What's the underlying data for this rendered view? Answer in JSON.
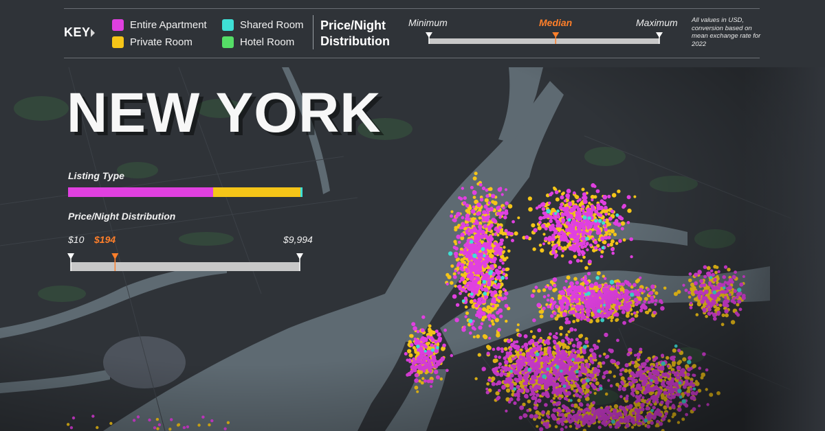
{
  "key": {
    "label": "KEY"
  },
  "legend": [
    {
      "label": "Entire Apartment",
      "color": "#e040e0"
    },
    {
      "label": "Private Room",
      "color": "#f5c518"
    },
    {
      "label": "Shared Room",
      "color": "#3ee0d6"
    },
    {
      "label": "Hotel Room",
      "color": "#55dd66"
    }
  ],
  "price_header": {
    "title_line1": "Price/Night",
    "title_line2": "Distribution",
    "min_label": "Minimum",
    "median_label": "Median",
    "max_label": "Maximum",
    "median_fraction": 0.55
  },
  "note": "All values in USD, conversion based on mean exchange rate for 2022",
  "city": {
    "name": "NEW YORK",
    "listing_type_title": "Listing Type",
    "listing_type_shares": {
      "entire_apartment": 0.62,
      "private_room": 0.37,
      "shared_room": 0.01,
      "hotel_room": 0.0
    },
    "price_title": "Price/Night Distribution",
    "price_min": "$10",
    "price_median": "$194",
    "price_max": "$9,994",
    "price_min_value": 10,
    "price_median_value": 194,
    "price_max_value": 9994
  },
  "colors": {
    "water": "#5e6a72",
    "land": "#2f3338",
    "park": "#34493c",
    "accent_median": "#ff7f2a",
    "scale_bar": "#c8c8c8"
  }
}
